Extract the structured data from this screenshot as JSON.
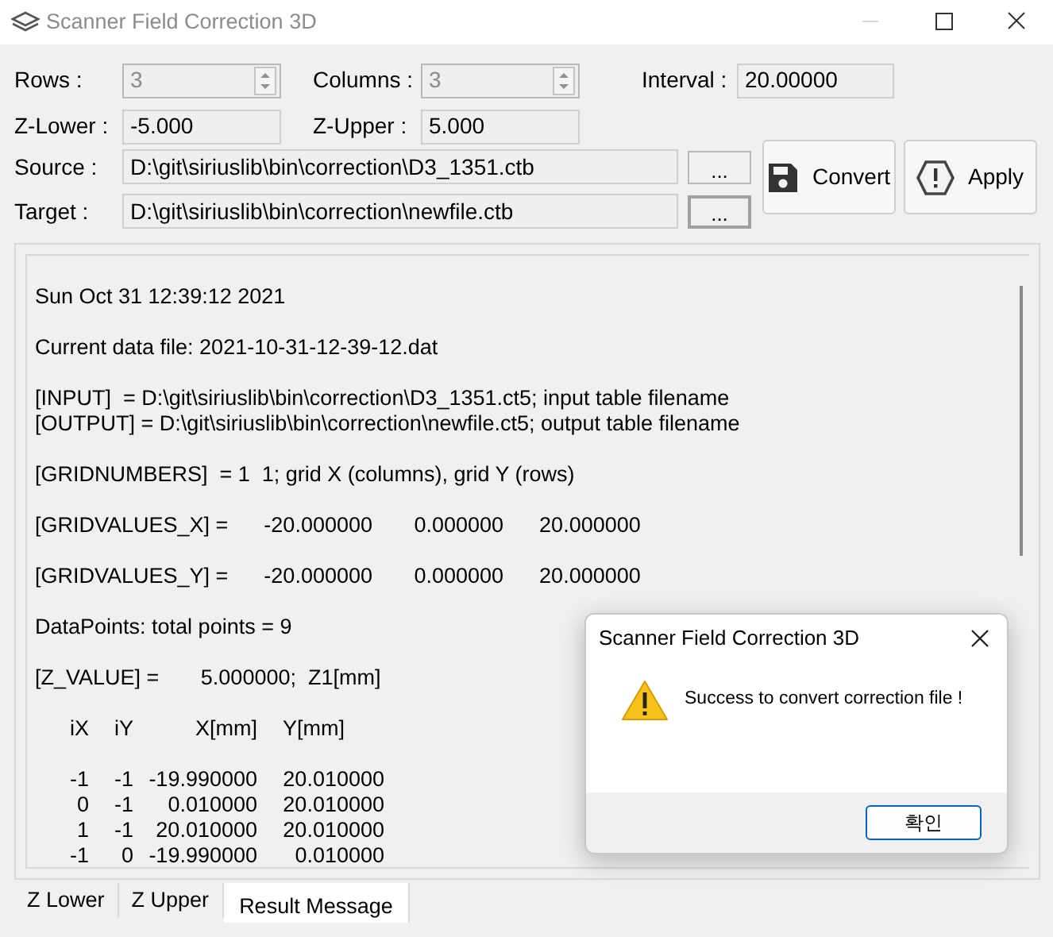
{
  "window": {
    "title": "Scanner Field Correction 3D"
  },
  "form": {
    "rows": {
      "label": "Rows :",
      "value": "3",
      "disabled": true
    },
    "columns": {
      "label": "Columns :",
      "value": "3",
      "disabled": true
    },
    "interval": {
      "label": "Interval :",
      "value": "20.00000"
    },
    "z_lower": {
      "label": "Z-Lower :",
      "value": "-5.000"
    },
    "z_upper": {
      "label": "Z-Upper :",
      "value": "5.000"
    },
    "source": {
      "label": "Source :",
      "value": "D:\\git\\siriuslib\\bin\\correction\\D3_1351.ctb",
      "browse": "..."
    },
    "target": {
      "label": "Target :",
      "value": "D:\\git\\siriuslib\\bin\\correction\\newfile.ctb",
      "browse": "..."
    }
  },
  "buttons": [
    {
      "label": "Convert",
      "kind": "save"
    },
    {
      "label": "Apply",
      "kind": "warning"
    }
  ],
  "log": {
    "blocks": [
      [
        "Sun Oct 31 12:39:12 2021"
      ],
      [
        "Current data file: 2021-10-31-12-39-12.dat"
      ],
      [
        "[INPUT]  = D:\\git\\siriuslib\\bin\\correction\\D3_1351.ct5; input table filename",
        "[OUTPUT] = D:\\git\\siriuslib\\bin\\correction\\newfile.ct5; output table filename"
      ],
      [
        "[GRIDNUMBERS]  = 1  1; grid X (columns), grid Y (rows)"
      ],
      [
        "[GRIDVALUES_X] =      -20.000000       0.000000      20.000000"
      ],
      [
        "[GRIDVALUES_Y] =      -20.000000       0.000000      20.000000"
      ],
      [
        "DataPoints: total points = 9"
      ],
      [
        "[Z_VALUE] =       5.000000;  Z1[mm]"
      ]
    ],
    "table": {
      "columns": [
        "iX",
        "iY",
        "X[mm]",
        "Y[mm]"
      ],
      "rows": [
        [
          "-1",
          "-1",
          "-19.990000",
          "20.010000"
        ],
        [
          "0",
          "-1",
          "0.010000",
          "20.010000"
        ],
        [
          "1",
          "-1",
          "20.010000",
          "20.010000"
        ],
        [
          "-1",
          "0",
          "-19.990000",
          "0.010000"
        ]
      ]
    }
  },
  "tabs": [
    {
      "label": "Z Lower",
      "selected": false
    },
    {
      "label": "Z Upper",
      "selected": false
    },
    {
      "label": "Result Message",
      "selected": true
    }
  ],
  "dialog": {
    "title": "Scanner Field Correction 3D",
    "message": "Success to convert correction file !",
    "button": "확인"
  }
}
